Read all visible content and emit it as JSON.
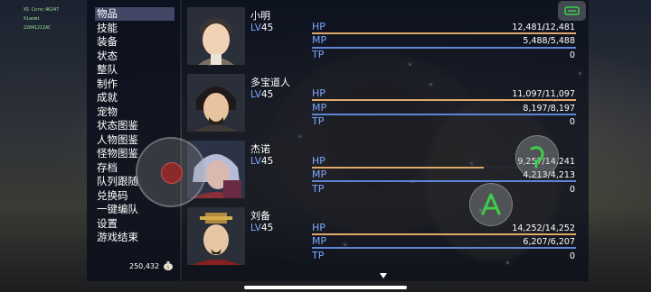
{
  "debug_lines": [
    "XS Core:46247",
    "Xiaomi",
    "2204121IAC"
  ],
  "menu": {
    "items": [
      "物品",
      "技能",
      "装备",
      "状态",
      "整队",
      "制作",
      "成就",
      "宠物",
      "状态图鉴",
      "人物图鉴",
      "怪物图鉴",
      "存档",
      "队列跟随",
      "兑换码",
      "一键编队",
      "设置",
      "游戏结束"
    ],
    "selected_index": 0
  },
  "gold": {
    "amount": "250,432",
    "icon": "money-bag-icon"
  },
  "stat_labels": {
    "hp": "HP",
    "mp": "MP",
    "tp": "TP"
  },
  "party": [
    {
      "name": "小明",
      "lv_label": "LV",
      "level": "45",
      "hp": "12,481/12,481",
      "mp": "5,488/5,488",
      "tp": "0",
      "hp_fraction": 1.0,
      "mp_fraction": 1.0,
      "tp_fraction": 0.0
    },
    {
      "name": "多宝道人",
      "lv_label": "LV",
      "level": "45",
      "hp": "11,097/11,097",
      "mp": "8,197/8,197",
      "tp": "0",
      "hp_fraction": 1.0,
      "mp_fraction": 1.0,
      "tp_fraction": 0.0
    },
    {
      "name": "杰诺",
      "lv_label": "LV",
      "level": "45",
      "hp": "9,257/14,241",
      "mp": "4,213/4,213",
      "tp": "0",
      "hp_fraction": 0.65,
      "mp_fraction": 1.0,
      "tp_fraction": 0.0
    },
    {
      "name": "刘备",
      "lv_label": "LV",
      "level": "45",
      "hp": "14,252/14,252",
      "mp": "6,207/6,207",
      "tp": "0",
      "hp_fraction": 1.0,
      "mp_fraction": 1.0,
      "tp_fraction": 0.0
    }
  ],
  "colors": {
    "hp_bar": "#e0a86a",
    "mp_bar": "#5f86d6",
    "stat_label": "#7da8ff",
    "menu_selected": "#6e73a0",
    "action_icon": "#3ecf4a"
  },
  "controls": {
    "joystick": "virtual-joystick",
    "confirm_button_icon": "confirm-triangle-icon",
    "cancel_button_icon": "cancel-icon",
    "menu_button_icon": "menu-icon"
  }
}
